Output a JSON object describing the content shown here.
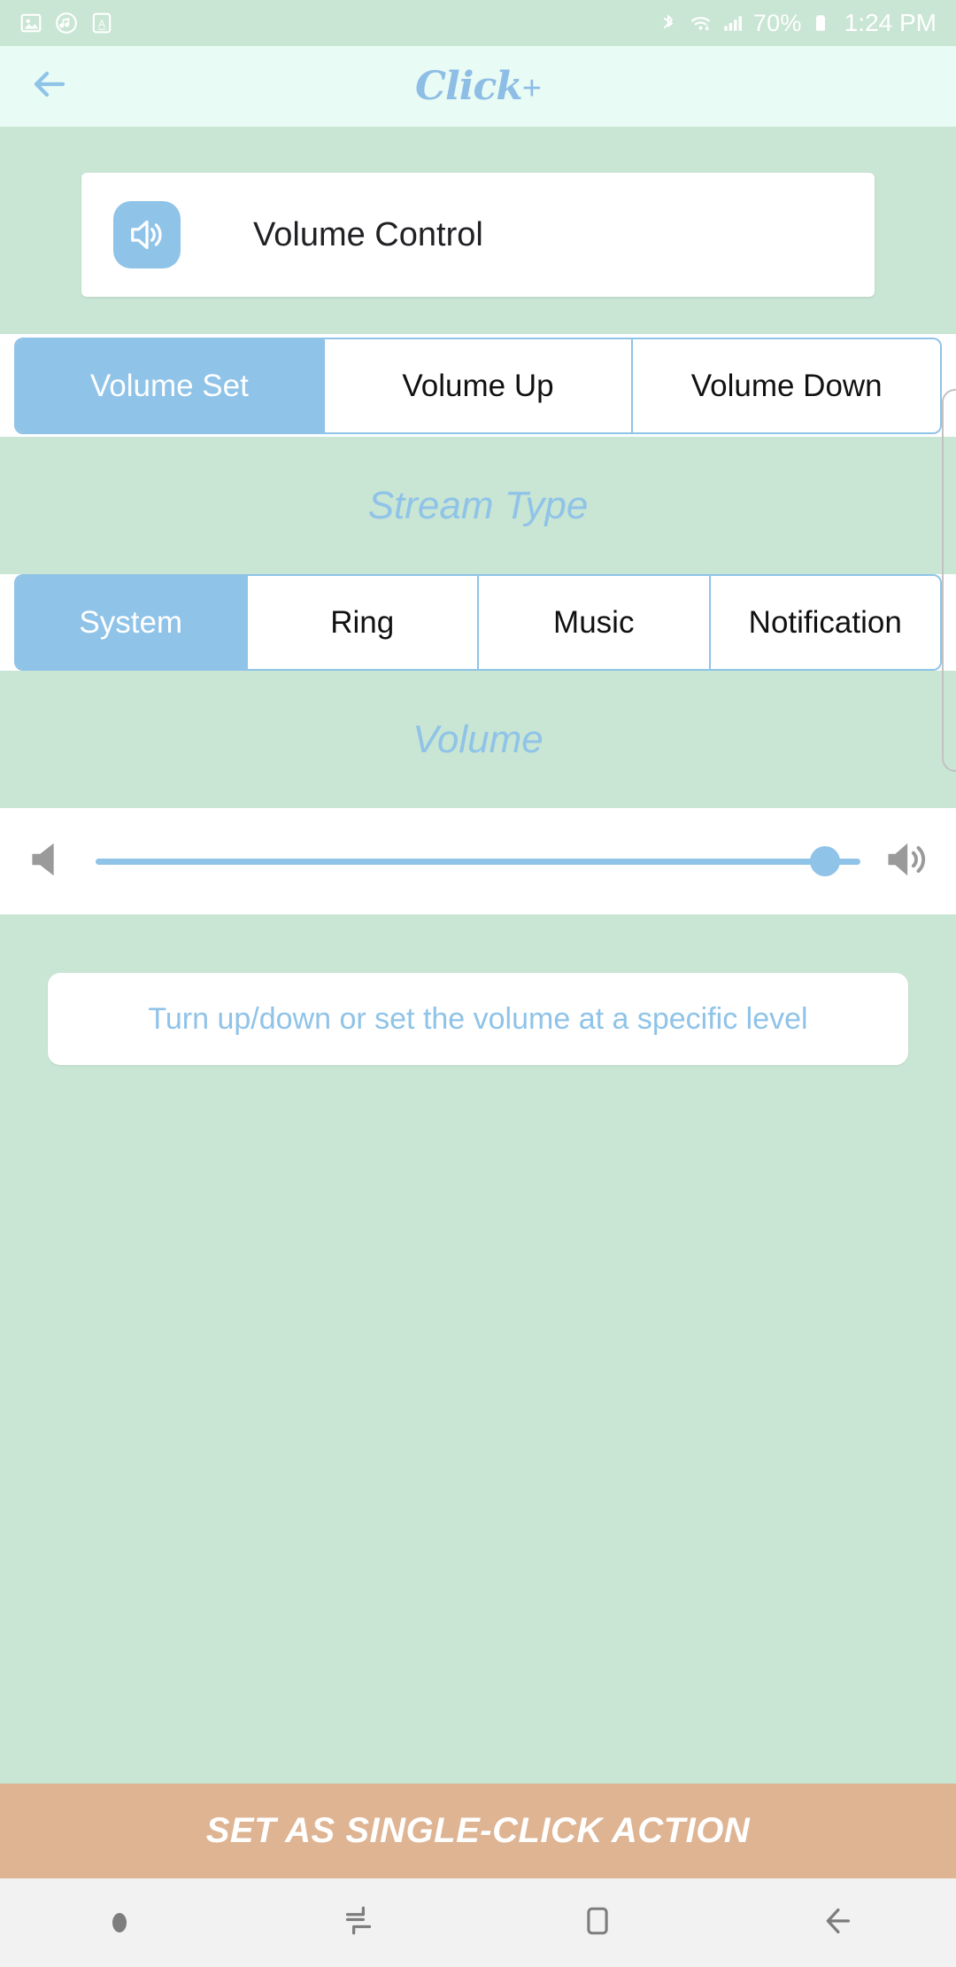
{
  "status_bar": {
    "left_icons": [
      "image-icon",
      "music-note-icon",
      "letter-a-icon"
    ],
    "right_icons": [
      "bluetooth-icon",
      "wifi-icon",
      "cellular-signal-icon",
      "battery-icon"
    ],
    "battery_percent": "70%",
    "time": "1:24 PM"
  },
  "app_bar": {
    "back_icon": "back-arrow-icon",
    "logo_text": "Click",
    "logo_plus": "+"
  },
  "action_card": {
    "icon": "volume-speaker-icon",
    "title": "Volume Control"
  },
  "mode_tabs": {
    "selected_index": 0,
    "items": [
      {
        "label": "Volume Set"
      },
      {
        "label": "Volume Up"
      },
      {
        "label": "Volume Down"
      }
    ]
  },
  "stream_section": {
    "label": "Stream Type",
    "selected_index": 0,
    "items": [
      {
        "label": "System"
      },
      {
        "label": "Ring"
      },
      {
        "label": "Music"
      },
      {
        "label": "Notification"
      }
    ]
  },
  "volume_section": {
    "label": "Volume",
    "slider": {
      "min_icon": "volume-mute-icon",
      "max_icon": "volume-high-icon",
      "value_percent": 96
    }
  },
  "description": {
    "text": "Turn up/down or set the volume at a specific level"
  },
  "bottom_action": {
    "label": "SET AS SINGLE-CLICK ACTION"
  },
  "nav_bar": {
    "items": [
      "dot-indicator",
      "recents-icon",
      "home-icon",
      "back-icon"
    ]
  },
  "colors": {
    "page_bg": "#c9e5d4",
    "app_bar_bg": "#e8fbf4",
    "accent_blue": "#8fc3e8",
    "action_bg": "#deb493",
    "nav_bg": "#f2f2f2"
  }
}
